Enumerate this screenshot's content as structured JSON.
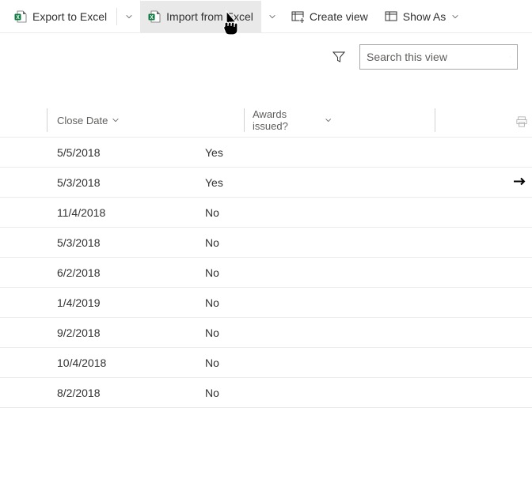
{
  "toolbar": {
    "export_label": "Export to Excel",
    "import_label": "Import from Excel",
    "create_view_label": "Create view",
    "show_as_label": "Show As"
  },
  "search": {
    "placeholder": "Search this view"
  },
  "columns": {
    "close_date": "Close Date",
    "awards_issued": "Awards issued?"
  },
  "rows": [
    {
      "close_date": "5/5/2018",
      "awards_issued": "Yes",
      "has_arrow": false
    },
    {
      "close_date": "5/3/2018",
      "awards_issued": "Yes",
      "has_arrow": true
    },
    {
      "close_date": "11/4/2018",
      "awards_issued": "No",
      "has_arrow": false
    },
    {
      "close_date": "5/3/2018",
      "awards_issued": "No",
      "has_arrow": false
    },
    {
      "close_date": "6/2/2018",
      "awards_issued": "No",
      "has_arrow": false
    },
    {
      "close_date": "1/4/2019",
      "awards_issued": "No",
      "has_arrow": false
    },
    {
      "close_date": "9/2/2018",
      "awards_issued": "No",
      "has_arrow": false
    },
    {
      "close_date": "10/4/2018",
      "awards_issued": "No",
      "has_arrow": false
    },
    {
      "close_date": "8/2/2018",
      "awards_issued": "No",
      "has_arrow": false
    }
  ]
}
